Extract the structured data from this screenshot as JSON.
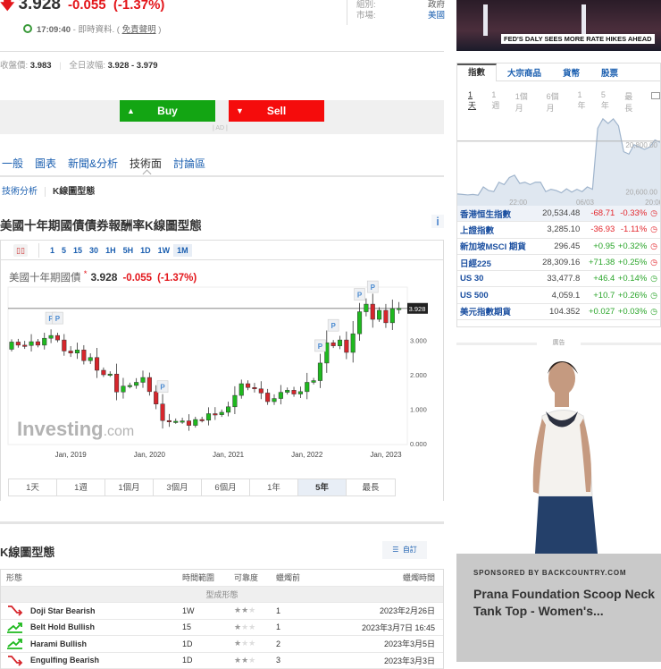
{
  "quote": {
    "arrow_icon": "down-arrow",
    "price": "3.928",
    "change": "-0.055",
    "change_pct": "(-1.37%)",
    "time": "17:09:40",
    "realtime_text": "- 即時資料. (",
    "disclaimer": "免責聲明",
    "close_paren": ")"
  },
  "info": {
    "group_label": "組別:",
    "group_value": "政府",
    "market_label": "市場:",
    "market_value": "美國"
  },
  "stats": {
    "prev_close_label": "收盤價:",
    "prev_close": "3.983",
    "day_range_label": "全日波幅:",
    "day_range": "3.928 - 3.979"
  },
  "trade": {
    "buy": "Buy",
    "sell": "Sell",
    "ad": "| AD |"
  },
  "tabs": [
    {
      "label": "一般"
    },
    {
      "label": "圖表"
    },
    {
      "label": "新聞&分析"
    },
    {
      "label": "技術面",
      "active": true
    },
    {
      "label": "討論區"
    }
  ],
  "subtabs": {
    "a": "技術分析",
    "b": "K線圖型態"
  },
  "page_title": "美國十年期國債債券報酬率K線圖型態",
  "info_icon": "i",
  "chart": {
    "intervals": [
      "1",
      "5",
      "15",
      "30",
      "1H",
      "5H",
      "1D",
      "1W",
      "1M"
    ],
    "active_interval": "1M",
    "label": "美國十年期國債",
    "label_mark": "*",
    "price": "3.928",
    "change": "-0.055",
    "change_pct": "(-1.37%)",
    "watermark_a": "Investing",
    "watermark_b": ".com",
    "ranges": [
      "1天",
      "1週",
      "1個月",
      "3個月",
      "6個月",
      "1年",
      "5年",
      "最長"
    ],
    "active_range": "5年"
  },
  "chart_data": {
    "type": "candlestick",
    "interval": "monthly",
    "start": "2018-04",
    "closes": [
      2.95,
      2.86,
      2.85,
      2.96,
      2.86,
      3.06,
      3.14,
      3.01,
      2.69,
      2.63,
      2.72,
      2.41,
      2.5,
      2.13,
      2.0,
      2.02,
      1.5,
      1.67,
      1.69,
      1.78,
      1.92,
      1.51,
      1.15,
      0.67,
      0.64,
      0.65,
      0.66,
      0.53,
      0.7,
      0.68,
      0.87,
      0.84,
      0.91,
      1.07,
      1.4,
      1.74,
      1.63,
      1.59,
      1.47,
      1.22,
      1.31,
      1.49,
      1.55,
      1.44,
      1.51,
      1.78,
      1.83,
      2.34,
      2.93,
      2.84,
      3.01,
      2.65,
      3.19,
      3.83,
      4.05,
      3.61,
      3.87,
      3.51,
      3.92,
      3.928
    ],
    "first_open": 2.74,
    "p_markers": [
      6,
      7,
      23,
      47,
      49,
      53,
      55
    ],
    "marker_label": "P",
    "last_price_label": "3.928",
    "ylim": [
      0,
      4.5
    ],
    "yticks": [
      "0.000",
      "1.000",
      "2.000",
      "3.000"
    ],
    "xticks": [
      {
        "label": "Jan, 2019",
        "index": 9
      },
      {
        "label": "Jan, 2020",
        "index": 21
      },
      {
        "label": "Jan, 2021",
        "index": 33
      },
      {
        "label": "Jan, 2022",
        "index": 45
      },
      {
        "label": "Jan, 2023",
        "index": 57
      }
    ]
  },
  "patterns": {
    "title": "K線圖型態",
    "custom_button": "自訂",
    "headers": [
      "形態",
      "時間範圍",
      "可靠度",
      "蠟燭前",
      "蠟燭時間"
    ],
    "group": "型成形態",
    "rows": [
      {
        "name": "Doji Star Bearish",
        "trend": "bearish",
        "timeframe": "1W",
        "reliability": 2,
        "candles_ago": "1",
        "time": "2023年2月26日"
      },
      {
        "name": "Belt Hold Bullish",
        "trend": "bullish",
        "timeframe": "15",
        "reliability": 1,
        "candles_ago": "1",
        "time": "2023年3月7日 16:45"
      },
      {
        "name": "Harami Bullish",
        "trend": "bullish",
        "timeframe": "1D",
        "reliability": 1,
        "candles_ago": "2",
        "time": "2023年3月5日"
      },
      {
        "name": "Engulfing Bearish",
        "trend": "bearish",
        "timeframe": "1D",
        "reliability": 2,
        "candles_ago": "3",
        "time": "2023年3月3日"
      }
    ]
  },
  "video": {
    "caption": "FED'S DALY SEES MORE RATE HIKES AHEAD"
  },
  "markets": {
    "tabs": [
      "指數",
      "大宗商品",
      "貨幣",
      "股票"
    ],
    "periods": [
      "1天",
      "1週",
      "1個月",
      "6個月",
      "1年",
      "5年",
      "最長"
    ],
    "mini_chart": {
      "values": [
        20590,
        20588,
        20586,
        20588,
        20585,
        20620,
        20605,
        20600,
        20640,
        20630,
        20660,
        20670,
        20635,
        20640,
        20630,
        20640,
        20640,
        20600,
        20610,
        20605,
        20595,
        20612,
        20598,
        20610,
        20600,
        20620,
        20610,
        20870,
        20910,
        20890,
        20910,
        20880,
        20770,
        20760,
        20800,
        20790,
        20780,
        20790,
        20820,
        20810
      ],
      "yticks": [
        "20,800.00",
        "20,600.00"
      ],
      "xticks": [
        "22:00",
        "06/03",
        "20:00"
      ],
      "ref_line": 20815
    },
    "rows": [
      {
        "name": "香港恒生指數",
        "price": "20,534.48",
        "change": "-68.71",
        "pct": "-0.33%",
        "dir": "down",
        "open": false
      },
      {
        "name": "上證指數",
        "price": "3,285.10",
        "change": "-36.93",
        "pct": "-1.11%",
        "dir": "down",
        "open": false
      },
      {
        "name": "新加坡MSCI 期貨",
        "price": "296.45",
        "change": "+0.95",
        "pct": "+0.32%",
        "dir": "up",
        "open": false
      },
      {
        "name": "日經225",
        "price": "28,309.16",
        "change": "+71.38",
        "pct": "+0.25%",
        "dir": "up",
        "open": false
      },
      {
        "name": "US 30",
        "price": "33,477.8",
        "change": "+46.4",
        "pct": "+0.14%",
        "dir": "up",
        "open": true
      },
      {
        "name": "US 500",
        "price": "4,059.1",
        "change": "+10.7",
        "pct": "+0.26%",
        "dir": "up",
        "open": true
      },
      {
        "name": "美元指數期貨",
        "price": "104.352",
        "change": "+0.027",
        "pct": "+0.03%",
        "dir": "up",
        "open": true
      }
    ]
  },
  "ad": {
    "label": "廣告",
    "sponsor": "SPONSORED BY BACKCOUNTRY.COM",
    "headline": "Prana Foundation Scoop Neck Tank Top - Women's..."
  },
  "colors": {
    "up": "#1fb91f",
    "down": "#d6262c",
    "buy": "#13a513",
    "sell": "#f50c0c",
    "link": "#1b5fb0"
  }
}
